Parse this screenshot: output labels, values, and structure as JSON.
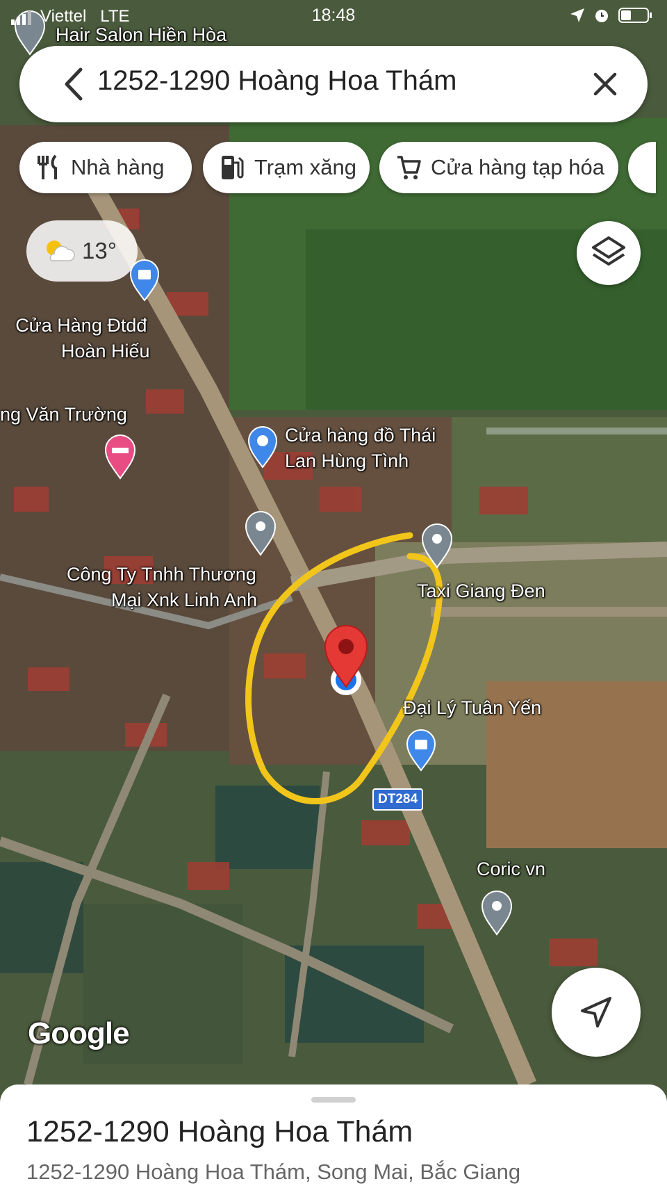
{
  "status_bar": {
    "carrier": "Viettel",
    "network": "LTE",
    "time": "18:48"
  },
  "search": {
    "query": "1252-1290 Hoàng Hoa Thám"
  },
  "chips": [
    {
      "label": "Nhà hàng",
      "icon": "utensils-icon"
    },
    {
      "label": "Trạm xăng",
      "icon": "gas-station-icon"
    },
    {
      "label": "Cửa hàng tạp hóa",
      "icon": "shopping-cart-icon"
    }
  ],
  "weather": {
    "temp": "13°",
    "icon": "partly-cloudy-icon"
  },
  "map_labels": {
    "hair_salon": "Hair Salon Hiền Hòa",
    "phone_store_1": "Cửa Hàng Đtdđ",
    "phone_store_2": "Hoàn Hiếu",
    "van_truong": "ng Văn Trường",
    "thai_store_1": "Cửa hàng đồ Thái",
    "thai_store_2": "Lan Hùng Tình",
    "company_1": "Công Ty Tnhh Thương",
    "company_2": "Mại Xnk Linh Anh",
    "taxi": "Taxi Giang Đen",
    "tuan_yen": "Đại Lý Tuân Yến",
    "coric": "Coric vn",
    "road": "DT284"
  },
  "watermark": "Google",
  "sheet": {
    "title": "1252-1290 Hoàng Hoa Thám",
    "subtitle": "1252-1290 Hoàng Hoa Thám, Song Mai, Bắc Giang"
  },
  "colors": {
    "pin_red": "#e53935",
    "annotation_yellow": "#f2c51b",
    "location_blue": "#1a73e8"
  }
}
